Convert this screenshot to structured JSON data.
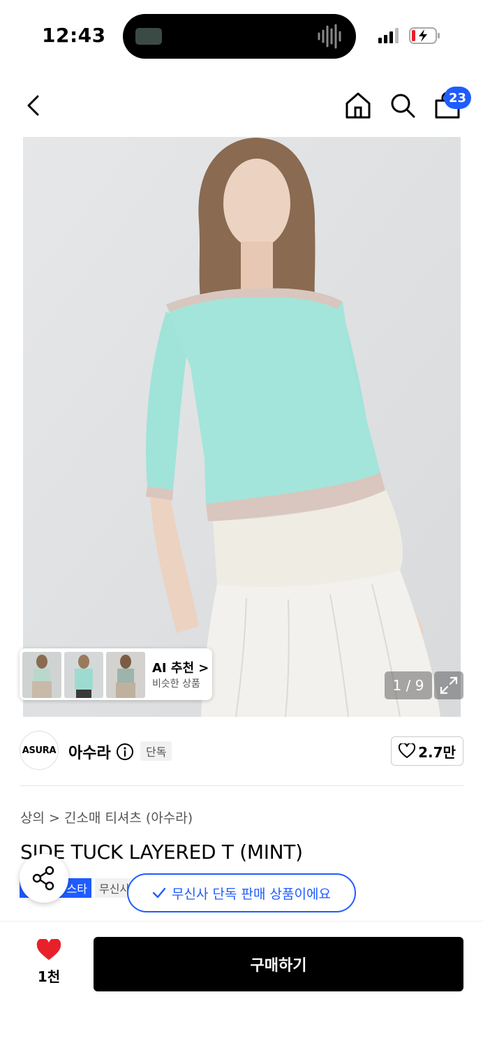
{
  "status_bar": {
    "time": "12:43"
  },
  "nav": {
    "cart_badge": "23"
  },
  "gallery": {
    "page_indicator": "1 / 9",
    "ai_card": {
      "title": "AI 추천 >",
      "subtitle": "비슷한 상품"
    }
  },
  "brand": {
    "logo_text": "ASURA",
    "name": "아수라",
    "tag": "단독",
    "likes": "2.7만"
  },
  "product": {
    "breadcrumb": "상의 > 긴소매 티셔츠 (아수라)",
    "title": "SIDE TUCK LAYERED T (MINT)",
    "tag_blue": "스타",
    "tag_gray": "무신사"
  },
  "toast": {
    "text": "무신사 단독 판매 상품이에요"
  },
  "bottom_bar": {
    "heart_count": "1천",
    "buy_label": "구매하기"
  },
  "colors": {
    "accent": "#1f5cff",
    "heart": "#e8202a",
    "buy_bg": "#000000"
  }
}
